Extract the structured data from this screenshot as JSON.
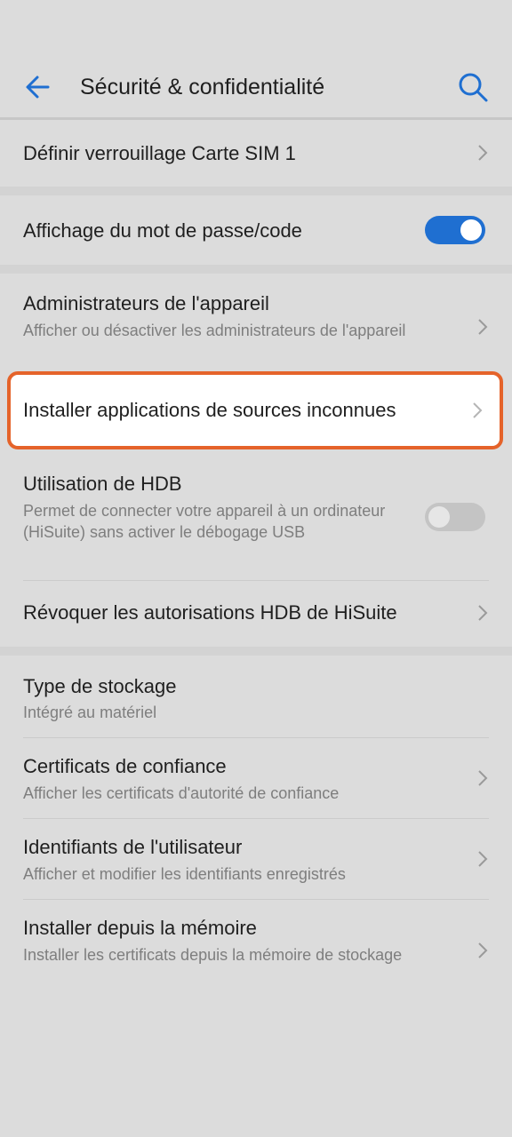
{
  "header": {
    "back_icon": "back-arrow-icon",
    "title": "Sécurité & confidentialité",
    "search_icon": "search-icon"
  },
  "colors": {
    "accent": "#1f6fd1",
    "highlight": "#e5632a",
    "toggle_off": "#c4c4c4",
    "background": "#dcdcdc"
  },
  "settings": {
    "sim_lock": {
      "label": "Définir verrouillage Carte SIM 1"
    },
    "password_display": {
      "label": "Affichage du mot de passe/code",
      "enabled": true
    },
    "device_admins": {
      "label": "Administrateurs de l'appareil",
      "sub": "Afficher ou désactiver les administrateurs de l'appareil"
    },
    "unknown_sources": {
      "label": "Installer applications de sources inconnues"
    },
    "hdb": {
      "label": "Utilisation de HDB",
      "sub": "Permet de connecter votre appareil à un ordinateur (HiSuite) sans activer le débogage USB",
      "enabled": false
    },
    "revoke_hdb": {
      "label": "Révoquer les autorisations HDB de HiSuite"
    },
    "storage_type": {
      "label": "Type de stockage",
      "sub": "Intégré au matériel"
    },
    "trusted_certs": {
      "label": "Certificats de confiance",
      "sub": "Afficher les certificats d'autorité de confiance"
    },
    "user_credentials": {
      "label": "Identifiants de l'utilisateur",
      "sub": "Afficher et modifier les identifiants enregistrés"
    },
    "install_from_storage": {
      "label": "Installer depuis la mémoire",
      "sub": "Installer les certificats depuis la mémoire de stockage"
    }
  }
}
